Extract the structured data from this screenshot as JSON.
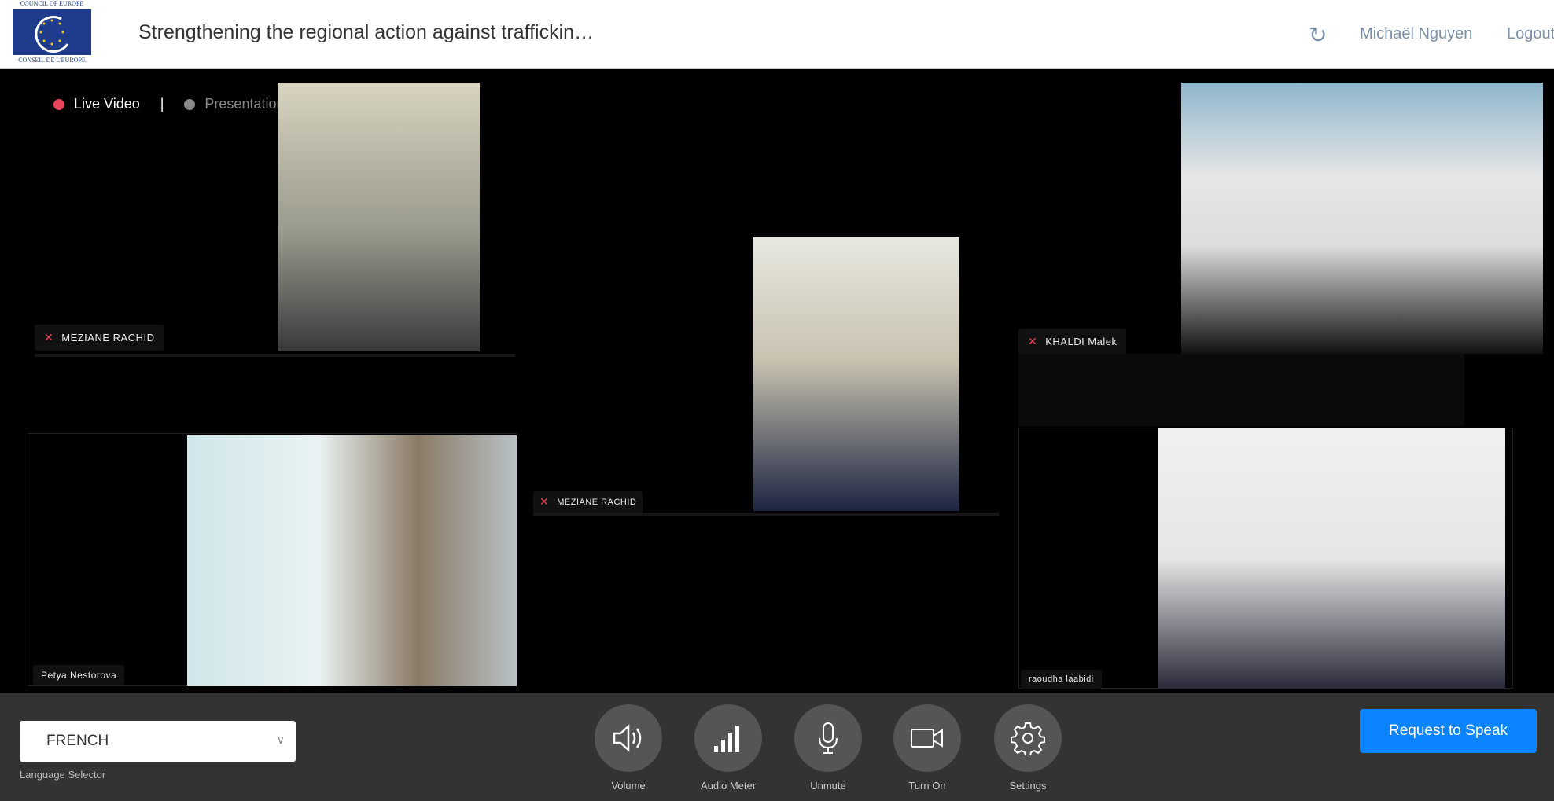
{
  "header": {
    "logo_top": "COUNCIL OF EUROPE",
    "logo_bottom": "CONSEIL DE L'EUROPE",
    "title": "Strengthening the regional action against traffickin…",
    "refresh_icon": "refresh-icon",
    "user_name": "Michaël Nguyen",
    "logout": "Logout"
  },
  "view_tabs": {
    "live": "Live Video",
    "separator": "|",
    "presentation": "Presentation",
    "live_color": "#e8445a",
    "presentation_color": "#888888"
  },
  "participants": [
    {
      "name": "MEZIANE RACHID",
      "muted": true
    },
    {
      "name": "MEZIANE RACHID",
      "muted": true
    },
    {
      "name": "KHALDI Malek",
      "muted": true
    },
    {
      "name": "Petya Nestorova",
      "muted": false
    },
    {
      "name": "raoudha laabidi",
      "muted": false
    }
  ],
  "controls": {
    "language": {
      "value": "FRENCH",
      "label": "Language Selector"
    },
    "buttons": [
      {
        "label": "Volume",
        "icon": "volume-icon"
      },
      {
        "label": "Audio Meter",
        "icon": "audio-meter-icon"
      },
      {
        "label": "Unmute",
        "icon": "microphone-icon"
      },
      {
        "label": "Turn On",
        "icon": "camera-icon"
      },
      {
        "label": "Settings",
        "icon": "gear-icon"
      }
    ],
    "request_to_speak": "Request to Speak",
    "accent": "#0a84ff"
  }
}
